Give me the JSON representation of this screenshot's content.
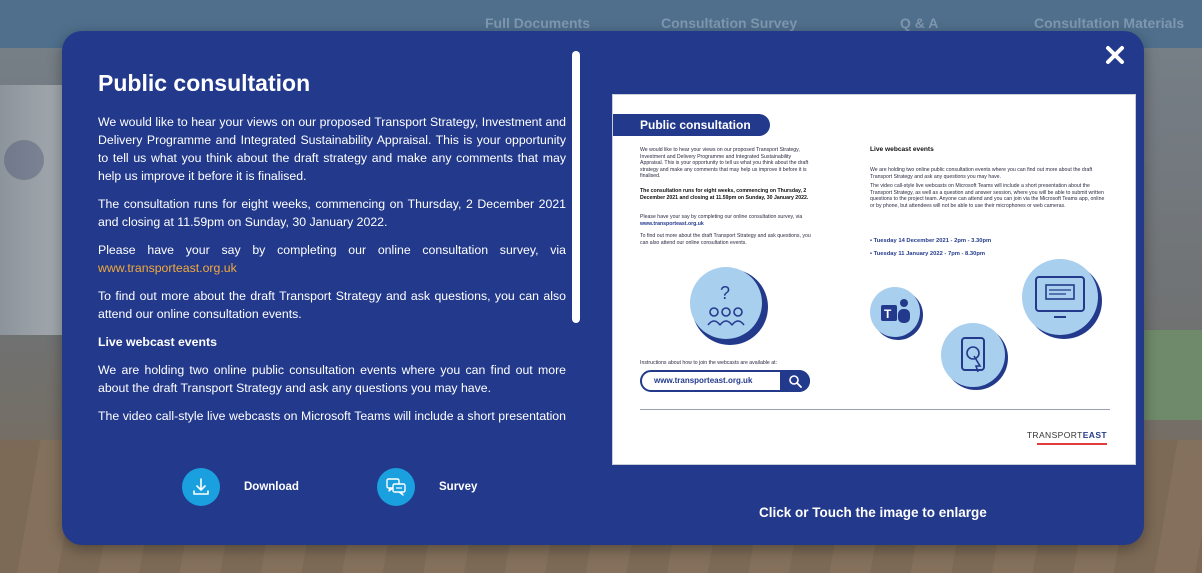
{
  "background_nav": {
    "links": [
      "Full Documents",
      "Consultation Survey",
      "Q & A",
      "Consultation Materials"
    ]
  },
  "modal": {
    "title": "Public consultation",
    "close_icon": "close-icon",
    "intro": "We would like to hear your views on our proposed Transport Strategy, Investment and Delivery Programme and Integrated Sustainability Appraisal. This is your opportunity to tell us what you think about the draft strategy and make any comments that may help us improve it before it is finalised.",
    "dates": "The consultation runs for eight weeks, commencing on Thursday, 2 December 2021 and closing at 11.59pm on Sunday, 30 January 2022.",
    "survey_prefix": "Please have your say by completing our online consultation survey, via",
    "survey_link": "www.transporteast.org.uk",
    "find_out": "To find out more about the draft Transport Strategy and ask questions, you can also attend our online consultation events.",
    "webcast_heading": "Live webcast events",
    "webcast_intro": "We are holding two online public consultation events where you can find out more about the draft Transport Strategy and ask any questions you may have.",
    "webcast_detail": "The video call-style live webcasts on Microsoft Teams will include a short presentation about the Transport Strategy, as well as a question and answer session, where you will",
    "actions": {
      "download_label": "Download",
      "survey_label": "Survey"
    },
    "enlarge_hint": "Click or Touch the  image to enlarge",
    "accent_color": "#233a8c",
    "link_color": "#f2a93b",
    "action_color": "#1aa0df"
  },
  "preview": {
    "title": "Public consultation",
    "col1_p1": "We would like to hear your views on our proposed Transport Strategy, Investment and Delivery Programme and Integrated Sustainability Appraisal. This is your opportunity to tell us what you think about the draft strategy and make any comments that may help us improve it before it is finalised.",
    "col1_p2": "The consultation runs for eight weeks, commencing on Thursday, 2 December 2021 and closing at 11.59pm on Sunday, 30 January 2022.",
    "col1_p3_prefix": "Please have your say by completing our online consultation survey, via",
    "col1_p3_link": "www.transporteast.org.uk",
    "col1_p4": "To find out more about the draft Transport Strategy and ask questions, you can also attend our online consultation events.",
    "col2_heading": "Live webcast events",
    "col2_p1": "We are holding two online public consultation events where you can find out more about the draft Transport Strategy and ask any questions you may have.",
    "col2_p2": "The video call-style live webcasts on Microsoft Teams will include a short presentation about the Transport Strategy, as well as a question and answer session, where you will be able to submit written questions to the project team. Anyone can attend and you can join via the Microsoft Teams app, online or by phone, but attendees will not be able to use their microphones or web cameras.",
    "event_1": "• Tuesday 14 December 2021 - 2pm - 3.30pm",
    "event_2": "• Tuesday 11 January 2022 - 7pm - 8.30pm",
    "instructions": "Instructions about how to join the webcasts are available at:",
    "url": "www.transporteast.org.uk",
    "logo_left": "TRANSPORT",
    "logo_right": "EAST"
  }
}
